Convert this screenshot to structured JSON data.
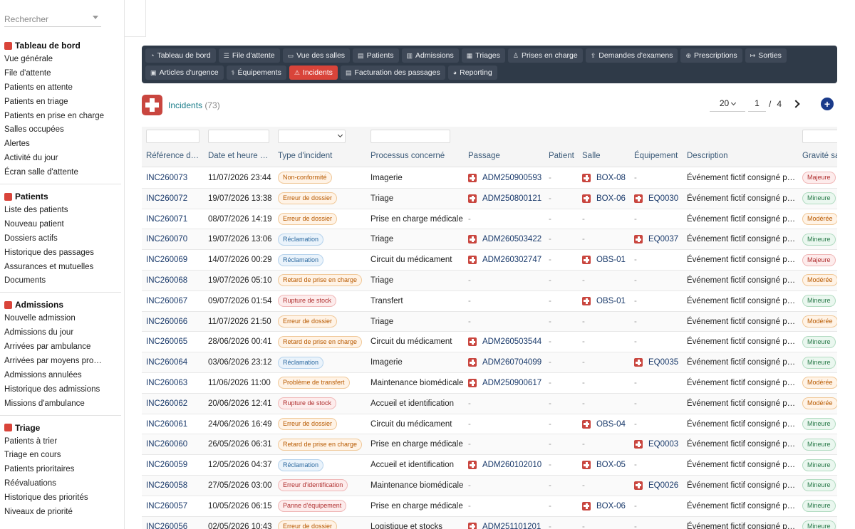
{
  "sidebar": {
    "search_placeholder": "Rechercher",
    "sections": [
      {
        "title": "Tableau de bord",
        "icon": "dashboard-icon",
        "color": "#d9443a",
        "items": [
          "Vue générale",
          "File d'attente",
          "Patients en attente",
          "Patients en triage",
          "Patients en prise en charge",
          "Salles occupées",
          "Alertes",
          "Activité du jour",
          "Écran salle d'attente"
        ]
      },
      {
        "title": "Patients",
        "icon": "id-card-icon",
        "color": "#d9443a",
        "items": [
          "Liste des patients",
          "Nouveau patient",
          "Dossiers actifs",
          "Historique des passages",
          "Assurances et mutuelles",
          "Documents"
        ]
      },
      {
        "title": "Admissions",
        "icon": "door-icon",
        "color": "#d9443a",
        "items": [
          "Nouvelle admission",
          "Admissions du jour",
          "Arrivées par ambulance",
          "Arrivées par moyens pro…",
          "Admissions annulées",
          "Historique des admissions",
          "Missions d'ambulance"
        ]
      },
      {
        "title": "Triage",
        "icon": "clipboard-icon",
        "color": "#d9443a",
        "items": [
          "Patients à trier",
          "Triage en cours",
          "Patients prioritaires",
          "Réévaluations",
          "Historique des priorités",
          "Niveaux de priorité"
        ]
      }
    ]
  },
  "topnav": {
    "row1": [
      {
        "label": "Tableau de bord",
        "icon": "gauge-icon",
        "glyph": "◔"
      },
      {
        "label": "File d'attente",
        "icon": "list-icon",
        "glyph": "☰"
      },
      {
        "label": "Vue des salles",
        "icon": "bed-icon",
        "glyph": "▭"
      },
      {
        "label": "Patients",
        "icon": "id-card-icon",
        "glyph": "▤"
      },
      {
        "label": "Admissions",
        "icon": "door-icon",
        "glyph": "▥"
      },
      {
        "label": "Triages",
        "icon": "clipboard-icon",
        "glyph": "▦"
      },
      {
        "label": "Prises en charge",
        "icon": "user-md-icon",
        "glyph": "♙"
      },
      {
        "label": "Demandes d'examens",
        "icon": "upload-icon",
        "glyph": "⇪"
      },
      {
        "label": "Prescriptions",
        "icon": "pills-icon",
        "glyph": "⊕"
      },
      {
        "label": "Sorties",
        "icon": "exit-icon",
        "glyph": "↦"
      }
    ],
    "row2": [
      {
        "label": "Articles d'urgence",
        "icon": "boxes-icon",
        "glyph": "▣"
      },
      {
        "label": "Équipements",
        "icon": "stethoscope-icon",
        "glyph": "⚕"
      },
      {
        "label": "Incidents",
        "icon": "warning-icon",
        "glyph": "⚠",
        "active": true
      },
      {
        "label": "Facturation des passages",
        "icon": "invoice-icon",
        "glyph": "▤"
      },
      {
        "label": "Reporting",
        "icon": "pie-icon",
        "glyph": "◕"
      }
    ]
  },
  "page": {
    "title": "Incidents",
    "count": "(73)"
  },
  "pager": {
    "page_size": "20",
    "current": "1",
    "separator": "/",
    "total": "4"
  },
  "table": {
    "headers": [
      "Référence d…",
      "Date et heure …",
      "Type d'incident",
      "Processus concerné",
      "Passage",
      "Patient",
      "Salle",
      "Équipement",
      "Description",
      "Gravité sa"
    ],
    "rows": [
      {
        "ref": "INC260073",
        "date": "11/07/2026 23:44",
        "type": "Non-conformité",
        "tc": "orange",
        "proc": "Imagerie",
        "passage": "ADM250900593",
        "patient": "-",
        "salle": "BOX-08",
        "equip": "-",
        "desc": "Événement fictif consigné p…",
        "grav": "Majeure",
        "gc": "maj"
      },
      {
        "ref": "INC260072",
        "date": "19/07/2026 13:38",
        "type": "Erreur de dossier",
        "tc": "orange",
        "proc": "Triage",
        "passage": "ADM250800121",
        "patient": "-",
        "salle": "BOX-06",
        "equip": "EQ0030",
        "desc": "Événement fictif consigné p…",
        "grav": "Mineure",
        "gc": "min"
      },
      {
        "ref": "INC260071",
        "date": "08/07/2026 14:19",
        "type": "Erreur de dossier",
        "tc": "orange",
        "proc": "Prise en charge médicale",
        "passage": "-",
        "patient": "-",
        "salle": "-",
        "equip": "-",
        "desc": "Événement fictif consigné p…",
        "grav": "Modérée",
        "gc": "mod"
      },
      {
        "ref": "INC260070",
        "date": "19/07/2026 13:06",
        "type": "Réclamation",
        "tc": "blue",
        "proc": "Triage",
        "passage": "ADM260503422",
        "patient": "-",
        "salle": "-",
        "equip": "EQ0037",
        "desc": "Événement fictif consigné p…",
        "grav": "Mineure",
        "gc": "min"
      },
      {
        "ref": "INC260069",
        "date": "14/07/2026 00:29",
        "type": "Réclamation",
        "tc": "blue",
        "proc": "Circuit du médicament",
        "passage": "ADM260302747",
        "patient": "-",
        "salle": "OBS-01",
        "equip": "-",
        "desc": "Événement fictif consigné p…",
        "grav": "Majeure",
        "gc": "maj"
      },
      {
        "ref": "INC260068",
        "date": "19/07/2026 05:10",
        "type": "Retard de prise en charge",
        "tc": "orange",
        "proc": "Triage",
        "passage": "-",
        "patient": "-",
        "salle": "-",
        "equip": "-",
        "desc": "Événement fictif consigné p…",
        "grav": "Modérée",
        "gc": "mod"
      },
      {
        "ref": "INC260067",
        "date": "09/07/2026 01:54",
        "type": "Rupture de stock",
        "tc": "red",
        "proc": "Transfert",
        "passage": "-",
        "patient": "-",
        "salle": "OBS-01",
        "equip": "-",
        "desc": "Événement fictif consigné p…",
        "grav": "Mineure",
        "gc": "min"
      },
      {
        "ref": "INC260066",
        "date": "11/07/2026 21:50",
        "type": "Erreur de dossier",
        "tc": "orange",
        "proc": "Triage",
        "passage": "-",
        "patient": "-",
        "salle": "-",
        "equip": "-",
        "desc": "Événement fictif consigné p…",
        "grav": "Modérée",
        "gc": "mod"
      },
      {
        "ref": "INC260065",
        "date": "28/06/2026 00:41",
        "type": "Retard de prise en charge",
        "tc": "orange",
        "proc": "Circuit du médicament",
        "passage": "ADM260503544",
        "patient": "-",
        "salle": "-",
        "equip": "-",
        "desc": "Événement fictif consigné p…",
        "grav": "Mineure",
        "gc": "min"
      },
      {
        "ref": "INC260064",
        "date": "03/06/2026 23:12",
        "type": "Réclamation",
        "tc": "blue",
        "proc": "Imagerie",
        "passage": "ADM260704099",
        "patient": "-",
        "salle": "-",
        "equip": "EQ0035",
        "desc": "Événement fictif consigné p…",
        "grav": "Mineure",
        "gc": "min"
      },
      {
        "ref": "INC260063",
        "date": "11/06/2026 11:00",
        "type": "Problème de transfert",
        "tc": "orange",
        "proc": "Maintenance biomédicale",
        "passage": "ADM250900617",
        "patient": "-",
        "salle": "-",
        "equip": "-",
        "desc": "Événement fictif consigné p…",
        "grav": "Modérée",
        "gc": "mod"
      },
      {
        "ref": "INC260062",
        "date": "20/06/2026 12:41",
        "type": "Rupture de stock",
        "tc": "red",
        "proc": "Accueil et identification",
        "passage": "-",
        "patient": "-",
        "salle": "-",
        "equip": "-",
        "desc": "Événement fictif consigné p…",
        "grav": "Modérée",
        "gc": "mod"
      },
      {
        "ref": "INC260061",
        "date": "24/06/2026 16:49",
        "type": "Erreur de dossier",
        "tc": "orange",
        "proc": "Circuit du médicament",
        "passage": "-",
        "patient": "-",
        "salle": "OBS-04",
        "equip": "-",
        "desc": "Événement fictif consigné p…",
        "grav": "Mineure",
        "gc": "min"
      },
      {
        "ref": "INC260060",
        "date": "26/05/2026 06:31",
        "type": "Retard de prise en charge",
        "tc": "orange",
        "proc": "Prise en charge médicale",
        "passage": "-",
        "patient": "-",
        "salle": "-",
        "equip": "EQ0003",
        "desc": "Événement fictif consigné p…",
        "grav": "Mineure",
        "gc": "min"
      },
      {
        "ref": "INC260059",
        "date": "12/05/2026 04:37",
        "type": "Réclamation",
        "tc": "blue",
        "proc": "Accueil et identification",
        "passage": "ADM260102010",
        "patient": "-",
        "salle": "BOX-05",
        "equip": "-",
        "desc": "Événement fictif consigné p…",
        "grav": "Mineure",
        "gc": "min"
      },
      {
        "ref": "INC260058",
        "date": "27/05/2026 03:00",
        "type": "Erreur d'identification",
        "tc": "red",
        "proc": "Maintenance biomédicale",
        "passage": "-",
        "patient": "-",
        "salle": "-",
        "equip": "EQ0026",
        "desc": "Événement fictif consigné p…",
        "grav": "Mineure",
        "gc": "min"
      },
      {
        "ref": "INC260057",
        "date": "10/05/2026 06:15",
        "type": "Panne d'équipement",
        "tc": "red",
        "proc": "Prise en charge médicale",
        "passage": "-",
        "patient": "-",
        "salle": "BOX-06",
        "equip": "-",
        "desc": "Événement fictif consigné p…",
        "grav": "Mineure",
        "gc": "min"
      },
      {
        "ref": "INC260056",
        "date": "02/05/2026 10:43",
        "type": "Erreur de dossier",
        "tc": "orange",
        "proc": "Logistique et stocks",
        "passage": "ADM251101201",
        "patient": "-",
        "salle": "-",
        "equip": "-",
        "desc": "Événement fictif consigné p…",
        "grav": "Mineure",
        "gc": "min"
      }
    ]
  }
}
